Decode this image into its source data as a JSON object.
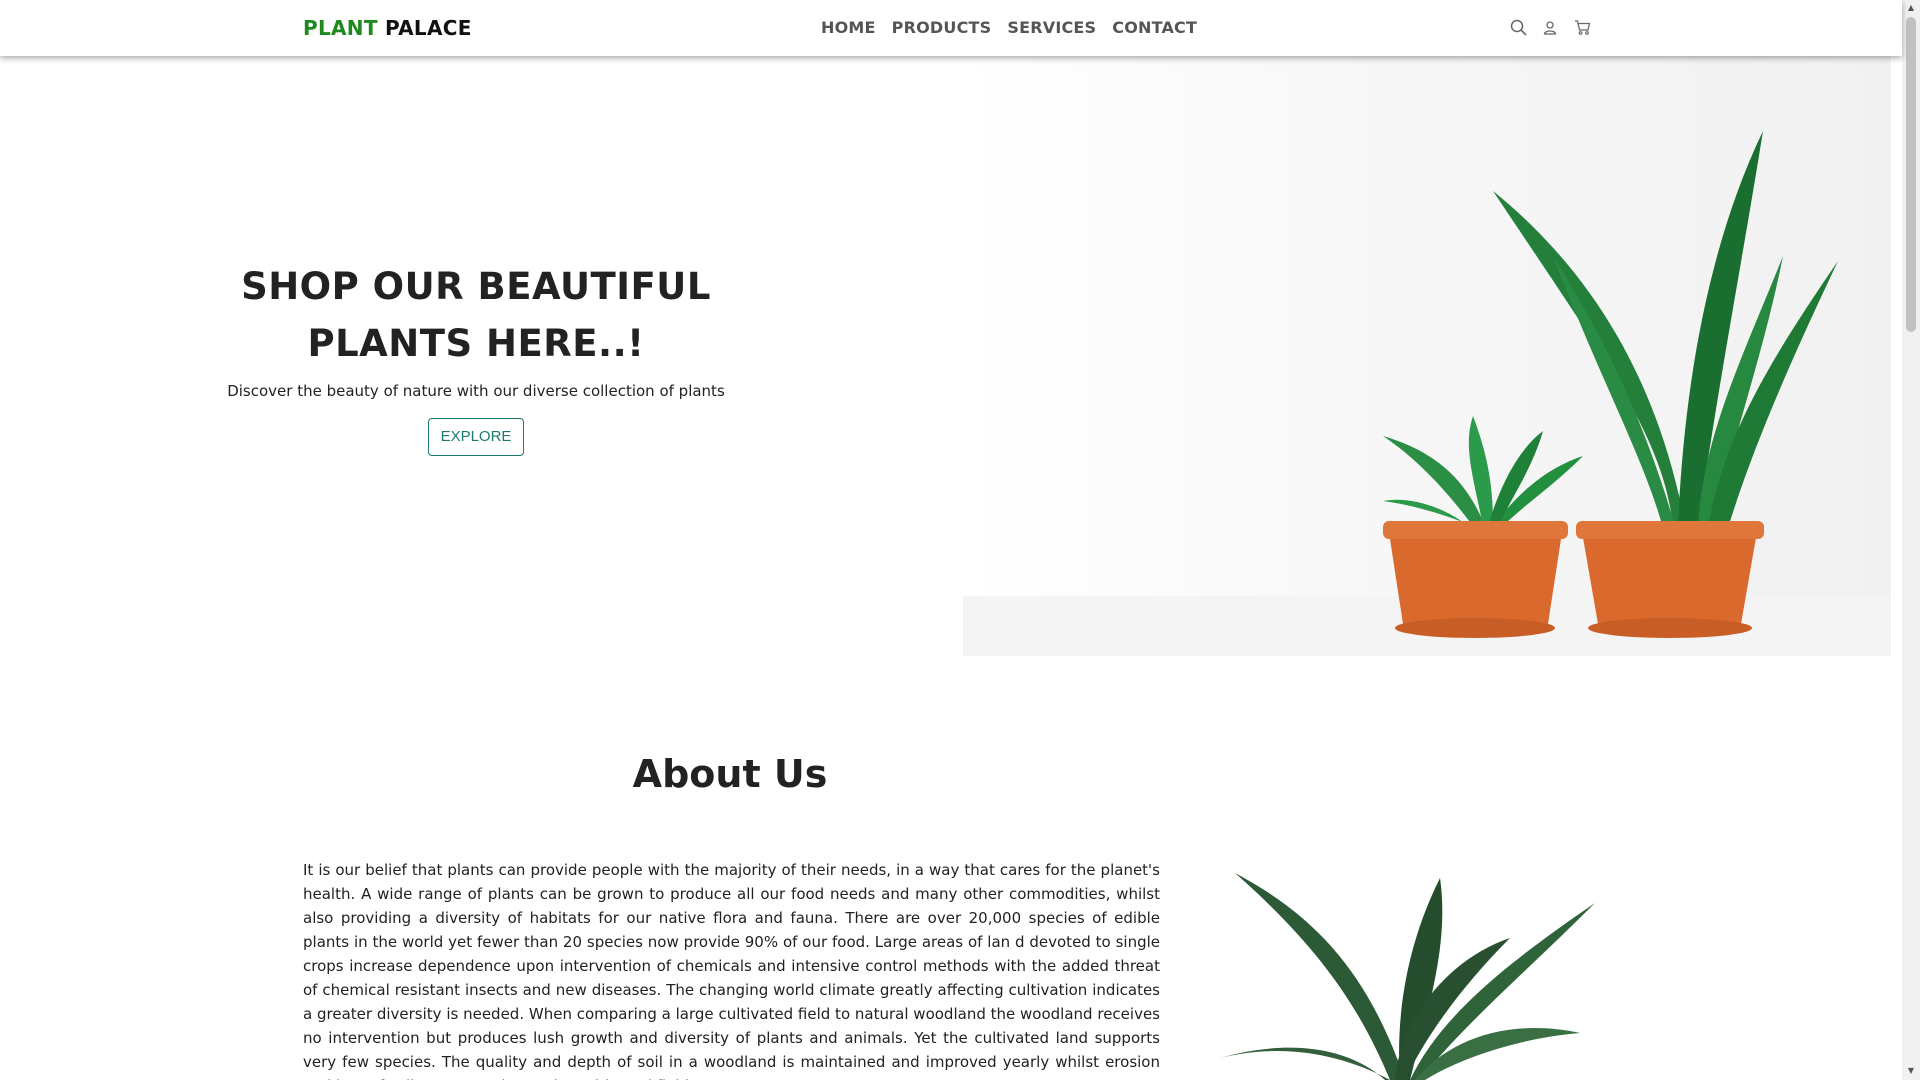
{
  "brand": {
    "part1": "PLANT",
    "part2": "PALACE"
  },
  "nav": {
    "links": [
      "HOME",
      "PRODUCTS",
      "SERVICES",
      "CONTACT"
    ]
  },
  "nav_icons": [
    "search-icon",
    "user-icon",
    "cart-icon"
  ],
  "hero": {
    "title_line1": "SHOP OUR BEAUTIFUL",
    "title_line2": "PLANTS HERE..!",
    "subtitle": "Discover the beauty of nature with our diverse collection of plants",
    "button_label": "EXPLORE"
  },
  "about": {
    "title": "About Us",
    "body": "It is our belief that plants can provide people with the majority of their needs, in a way that cares for the planet's health. A wide range of plants can be grown to produce all our food needs and many other commodities, whilst also providing a diversity of habitats for our native flora and fauna. There are over 20,000 species of edible plants in the world yet fewer than 20 species now provide 90% of our food. Large areas of lan d devoted to single crops increase dependence upon intervention of chemicals and intensive control methods with the added threat of chemical resistant insects and new diseases. The changing world climate greatly affecting cultivation indicates a greater diversity is needed. When comparing a large cultivated field to natural woodland the woodland receives no intervention but produces lush growth and diversity of plants and animals. Yet the cultivated land supports very few species. The quality and depth of soil in a woodland is maintained and improved yearly whilst erosion and loss of soil structure plague the cultivated field. Our"
  },
  "colors": {
    "brand_green": "#1e8a1e",
    "button_teal": "#1a7a6c",
    "pot_orange": "#d9692c",
    "leaf_green": "#1f7a35"
  }
}
